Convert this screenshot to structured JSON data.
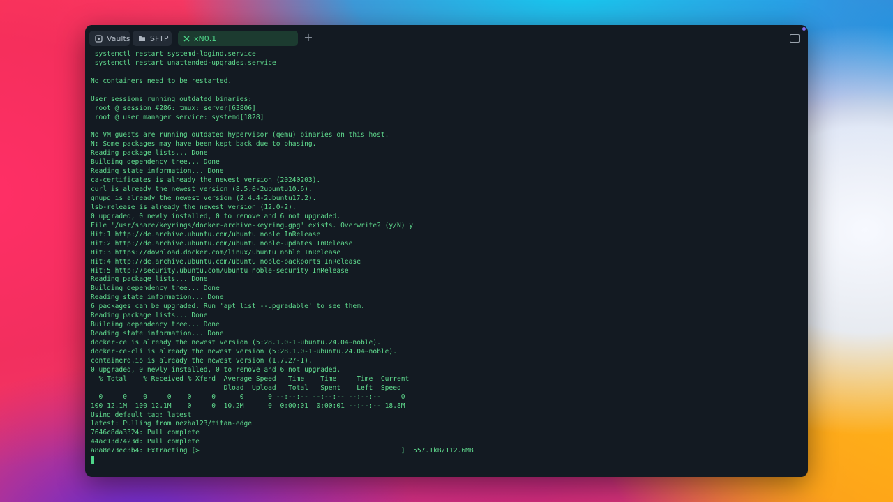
{
  "tabs": [
    {
      "label": "Vaults",
      "icon": "vault-icon"
    },
    {
      "label": "SFTP",
      "icon": "folder-icon"
    },
    {
      "label": "xN0.1",
      "icon": "close-icon",
      "active": true
    }
  ],
  "accent_color": "#4fd68a",
  "terminal": {
    "lines": [
      " systemctl restart systemd-logind.service",
      " systemctl restart unattended-upgrades.service",
      "",
      "No containers need to be restarted.",
      "",
      "User sessions running outdated binaries:",
      " root @ session #286: tmux: server[63806]",
      " root @ user manager service: systemd[1828]",
      "",
      "No VM guests are running outdated hypervisor (qemu) binaries on this host.",
      "N: Some packages may have been kept back due to phasing.",
      "Reading package lists... Done",
      "Building dependency tree... Done",
      "Reading state information... Done",
      "ca-certificates is already the newest version (20240203).",
      "curl is already the newest version (8.5.0-2ubuntu10.6).",
      "gnupg is already the newest version (2.4.4-2ubuntu17.2).",
      "lsb-release is already the newest version (12.0-2).",
      "0 upgraded, 0 newly installed, 0 to remove and 6 not upgraded.",
      "File '/usr/share/keyrings/docker-archive-keyring.gpg' exists. Overwrite? (y/N) y",
      "Hit:1 http://de.archive.ubuntu.com/ubuntu noble InRelease",
      "Hit:2 http://de.archive.ubuntu.com/ubuntu noble-updates InRelease",
      "Hit:3 https://download.docker.com/linux/ubuntu noble InRelease",
      "Hit:4 http://de.archive.ubuntu.com/ubuntu noble-backports InRelease",
      "Hit:5 http://security.ubuntu.com/ubuntu noble-security InRelease",
      "Reading package lists... Done",
      "Building dependency tree... Done",
      "Reading state information... Done",
      "6 packages can be upgraded. Run 'apt list --upgradable' to see them.",
      "Reading package lists... Done",
      "Building dependency tree... Done",
      "Reading state information... Done",
      "docker-ce is already the newest version (5:28.1.0-1~ubuntu.24.04~noble).",
      "docker-ce-cli is already the newest version (5:28.1.0-1~ubuntu.24.04~noble).",
      "containerd.io is already the newest version (1.7.27-1).",
      "0 upgraded, 0 newly installed, 0 to remove and 6 not upgraded.",
      "  % Total    % Received % Xferd  Average Speed   Time    Time     Time  Current",
      "                                 Dload  Upload   Total   Spent    Left  Speed",
      "  0     0    0     0    0     0      0      0 --:--:-- --:--:-- --:--:--     0",
      "100 12.1M  100 12.1M    0     0  10.2M      0  0:00:01  0:00:01 --:--:-- 18.8M",
      "Using default tag: latest",
      "latest: Pulling from nezha123/titan-edge",
      "7646c8da3324: Pull complete",
      "44ac13d7423d: Pull complete",
      "a8a8e73ec3b4: Extracting [>                                                  ]  557.1kB/112.6MB"
    ]
  }
}
